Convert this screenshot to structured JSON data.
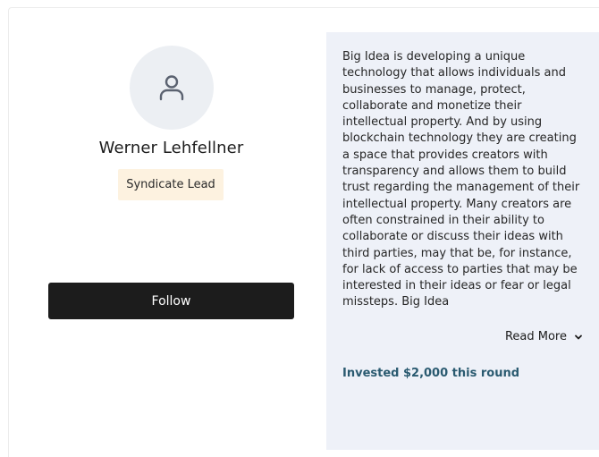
{
  "profile": {
    "name": "Werner Lehfellner",
    "role_badge": "Syndicate Lead",
    "avatar_icon": "user-icon",
    "follow_label": "Follow"
  },
  "panel": {
    "description": "Big Idea is developing a unique technology that allows individuals and businesses to manage, protect, collaborate and monetize their intellectual property. And by using blockchain technology they are creating a space that provides creators with transparency and allows them to build trust regarding the management of their intellectual property. Many creators are often constrained in their ability to collaborate or discuss their ideas with third parties, may that be, for instance, for lack of access to parties that may be interested in their ideas or fear or legal missteps. Big Idea",
    "read_more_label": "Read More",
    "read_more_icon": "chevron-down-icon",
    "invested_text": "Invested $2,000 this round"
  },
  "colors": {
    "button_bg": "#1c1c1c",
    "badge_bg": "#fdf2e0",
    "panel_bg": "#eef1f8",
    "invested_text": "#2a5a70"
  }
}
